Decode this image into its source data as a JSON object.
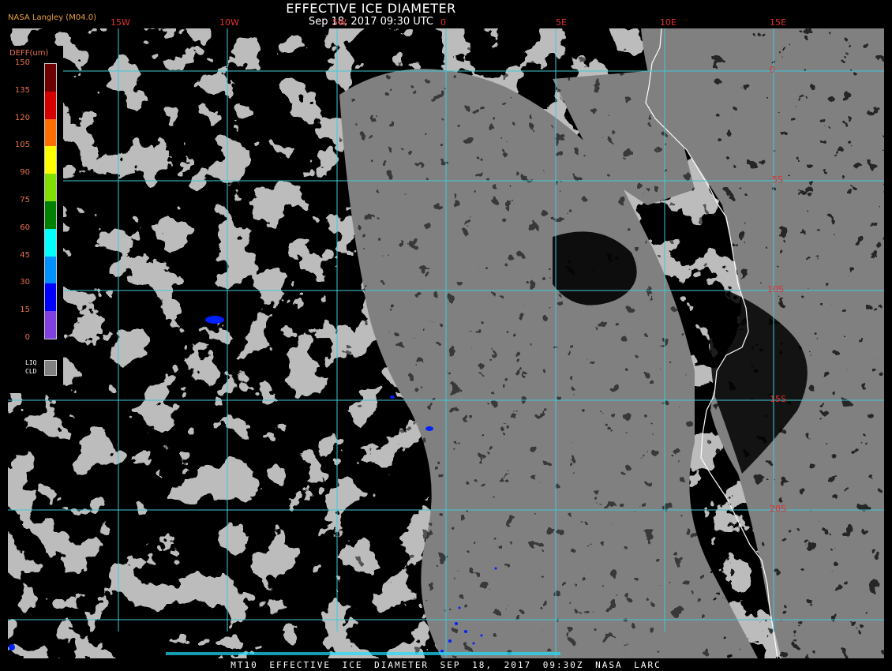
{
  "header": {
    "title": "EFFECTIVE ICE DIAMETER",
    "subtitle": "Sep 18, 2017 09:30 UTC",
    "agency": "NASA Langley (M04.0)"
  },
  "footer": {
    "text": "MT10  EFFECTIVE ICE DIAMETER  SEP 18, 2017 09:30Z  NASA LARC"
  },
  "legend": {
    "title": "DEFF(um)",
    "ticks": [
      "150",
      "135",
      "120",
      "105",
      "90",
      "75",
      "60",
      "45",
      "30",
      "15",
      "0"
    ],
    "colors": [
      "#6b0000",
      "#d40000",
      "#ff7000",
      "#ffff00",
      "#80e000",
      "#008000",
      "#00ffff",
      "#0090ff",
      "#0000ff",
      "#8040e0"
    ],
    "liquid_label_line1": "LIQ",
    "liquid_label_line2": "CLD",
    "liquid_color": "#808080"
  },
  "map": {
    "longitude_labels": [
      "15W",
      "10W",
      "5W",
      "0",
      "5E",
      "10E",
      "15E"
    ],
    "latitude_labels": [
      "0",
      "5S",
      "10S",
      "15S",
      "20S"
    ],
    "colors": {
      "background": "#000000",
      "liquid_cloud": "#808080",
      "gridline": "#40c8d8",
      "coastline": "#ffffff",
      "ice": "#0000ff"
    }
  }
}
